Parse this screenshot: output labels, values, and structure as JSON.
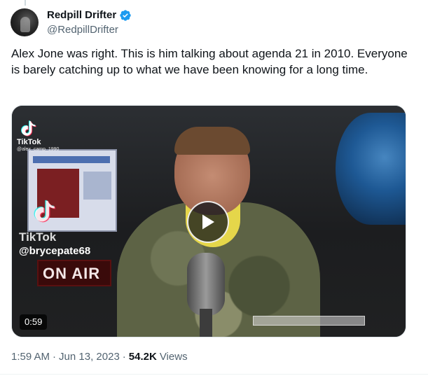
{
  "author": {
    "display_name": "Redpill Drifter",
    "handle": "@RedpillDrifter",
    "verified": true,
    "verified_color": "#1d9bf0",
    "avatar_icon": "avatar-image"
  },
  "tweet": {
    "text": "Alex Jone was right. This is him talking about agenda 21 in 2010. Everyone is barely catching up to what we have been knowing for a long time."
  },
  "media": {
    "type": "video",
    "duration": "0:59",
    "overlay": {
      "tiktok_label_top": "TikTok",
      "tiktok_user_top": "@alex_camp_1990",
      "tiktok_label_mid": "TikTok",
      "tiktok_user_mid": "@brycepate68",
      "on_air": "ON AIR"
    },
    "play_icon": "play-icon"
  },
  "meta": {
    "time": "1:59 AM",
    "date": "Jun 13, 2023",
    "views_count": "54.2K",
    "views_label": "Views"
  }
}
